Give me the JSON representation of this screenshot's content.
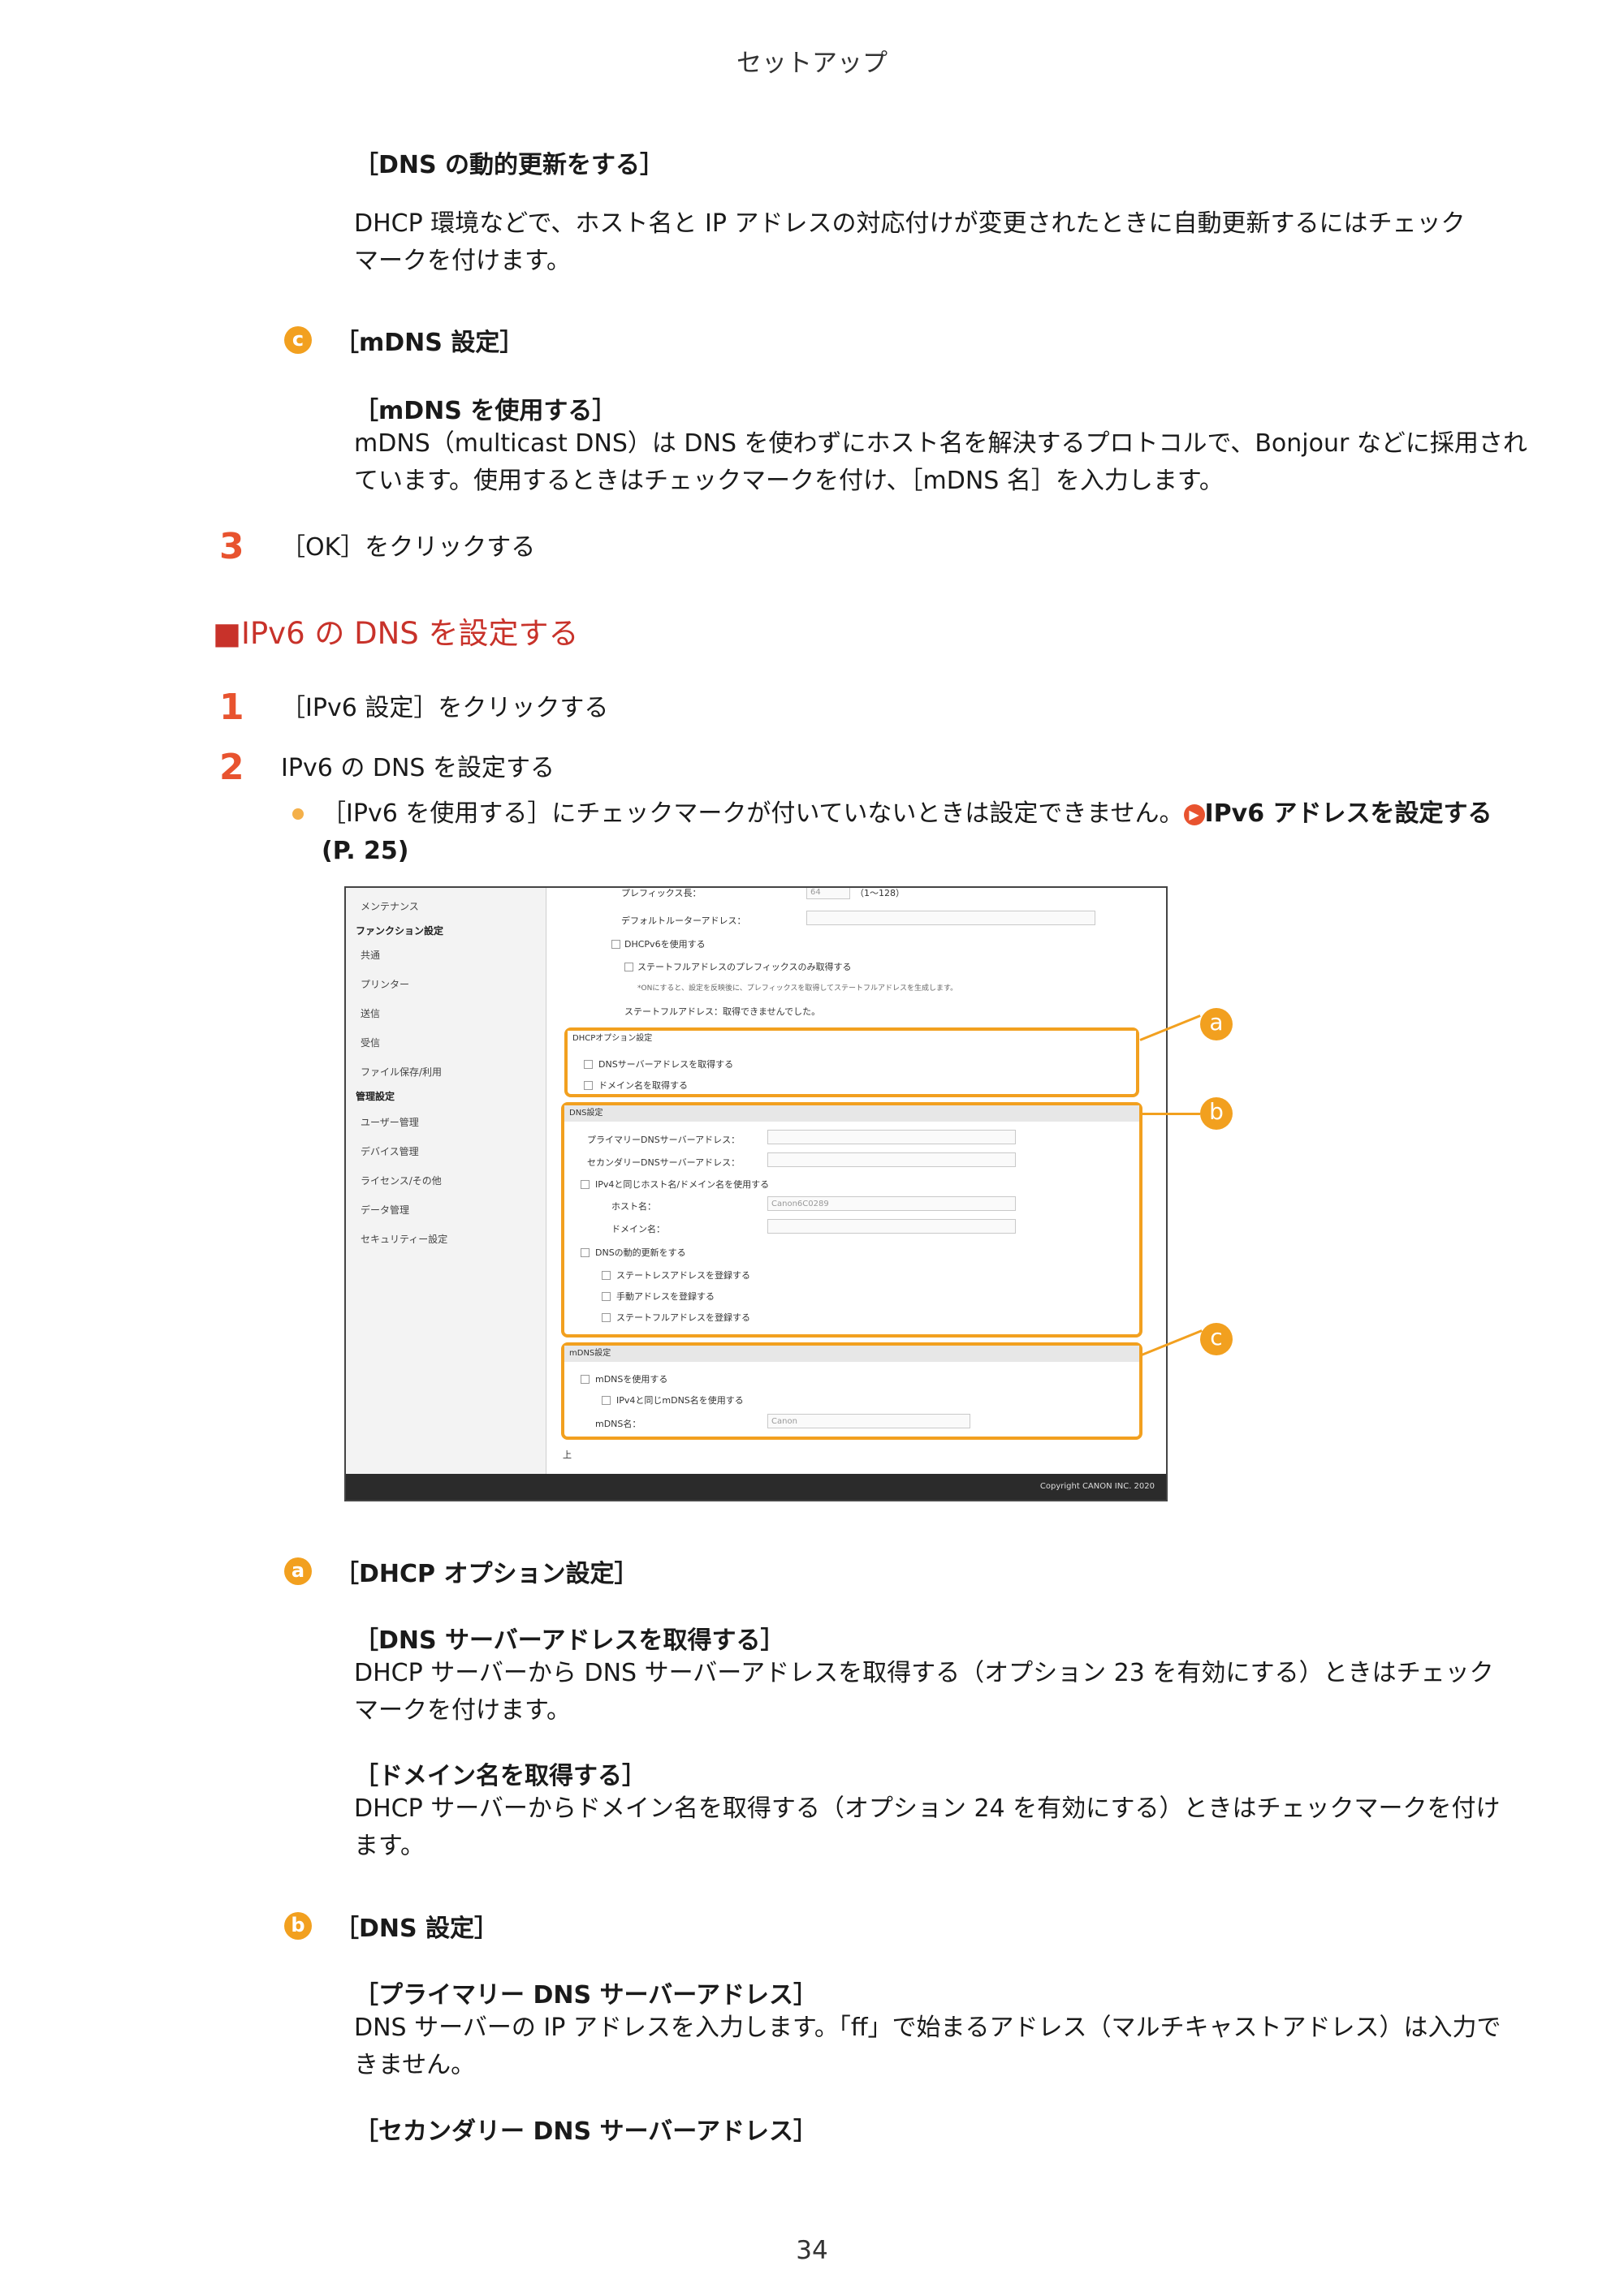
{
  "header": "セットアップ",
  "page_number": "34",
  "dns_update": {
    "title": "［DNS の動的更新をする］",
    "text1": "DHCP 環境などで、ホスト名と IP アドレスの対応付けが変更されたときに自動更新するにはチェック",
    "text2": "マークを付けます。"
  },
  "mdns": {
    "badge": "c",
    "title": "［mDNS 設定］",
    "sub_title": "［mDNS を使用する］",
    "text1": "mDNS（multicast DNS）は DNS を使わずにホスト名を解決するプロトコルで、Bonjour などに採用され",
    "text2": "ています。使用するときはチェックマークを付け、［mDNS 名］を入力します。"
  },
  "step3": {
    "num": "3",
    "text": "［OK］をクリックする"
  },
  "section": {
    "title": "■IPv6 の DNS を設定する"
  },
  "step1": {
    "num": "1",
    "text": "［IPv6 設定］をクリックする"
  },
  "step2": {
    "num": "2",
    "text": "IPv6 の DNS を設定する"
  },
  "note": {
    "text": "［IPv6 を使用する］にチェックマークが付いていないときは設定できません。",
    "link_icon": "▶",
    "link": "IPv6 アドレスを設定する",
    "link_page": "(P. 25)"
  },
  "screenshot": {
    "sidebar": {
      "items": [
        {
          "label": "メンテナンス",
          "head": false
        },
        {
          "label": "ファンクション設定",
          "head": true
        },
        {
          "label": "共通",
          "head": false
        },
        {
          "label": "プリンター",
          "head": false
        },
        {
          "label": "送信",
          "head": false
        },
        {
          "label": "受信",
          "head": false
        },
        {
          "label": "ファイル保存/利用",
          "head": false
        },
        {
          "label": "管理設定",
          "head": true
        },
        {
          "label": "ユーザー管理",
          "head": false
        },
        {
          "label": "デバイス管理",
          "head": false
        },
        {
          "label": "ライセンス/その他",
          "head": false
        },
        {
          "label": "データ管理",
          "head": false
        },
        {
          "label": "セキュリティー設定",
          "head": false
        }
      ]
    },
    "top": {
      "prefix_label": "プレフィックス長：",
      "prefix_value": "64",
      "prefix_range": "（1～128）",
      "router_label": "デフォルトルーターアドレス：",
      "dhcpv6_label": "DHCPv6を使用する",
      "stateful_prefix_label": "ステートフルアドレスのプレフィックスのみ取得する",
      "note_label": "*ONにすると、設定を反映後に、プレフィックスを取得してステートフルアドレスを生成します。",
      "stateful_label": "ステートフルアドレス：取得できませんでした。"
    },
    "dhcp_group": {
      "title": "DHCPオプション設定",
      "get_dns": "DNSサーバーアドレスを取得する",
      "get_domain": "ドメイン名を取得する"
    },
    "dns_group": {
      "title": "DNS設定",
      "primary": "プライマリーDNSサーバーアドレス：",
      "secondary": "セカンダリーDNSサーバーアドレス：",
      "same_host": "IPv4と同じホスト名/ドメイン名を使用する",
      "host_label": "ホスト名：",
      "host_value": "Canon6C0289",
      "domain_label": "ドメイン名：",
      "dynamic": "DNSの動的更新をする",
      "stateless": "ステートレスアドレスを登録する",
      "manual": "手動アドレスを登録する",
      "stateful": "ステートフルアドレスを登録する"
    },
    "mdns_group": {
      "title": "mDNS設定",
      "use": "mDNSを使用する",
      "same": "IPv4と同じmDNS名を使用する",
      "name_label": "mDNS名：",
      "name_value": "Canon"
    },
    "top_link": "上",
    "copyright": "Copyright CANON INC. 2020",
    "callouts": [
      "a",
      "b",
      "c"
    ]
  },
  "dhcp_opt": {
    "badge": "a",
    "title": "［DHCP オプション設定］",
    "s1_title": "［DNS サーバーアドレスを取得する］",
    "s1_text1": "DHCP サーバーから DNS サーバーアドレスを取得する（オプション 23 を有効にする）ときはチェック",
    "s1_text2": "マークを付けます。",
    "s2_title": "［ドメイン名を取得する］",
    "s2_text1": "DHCP サーバーからドメイン名を取得する（オプション 24 を有効にする）ときはチェックマークを付け",
    "s2_text2": "ます。"
  },
  "dns_set": {
    "badge": "b",
    "title": "［DNS 設定］",
    "s1_title": "［プライマリー DNS サーバーアドレス］",
    "s1_text1": "DNS サーバーの IP アドレスを入力します。「ff」で始まるアドレス（マルチキャストアドレス）は入力で",
    "s1_text2": "きません。",
    "s2_title": "［セカンダリー DNS サーバーアドレス］"
  }
}
